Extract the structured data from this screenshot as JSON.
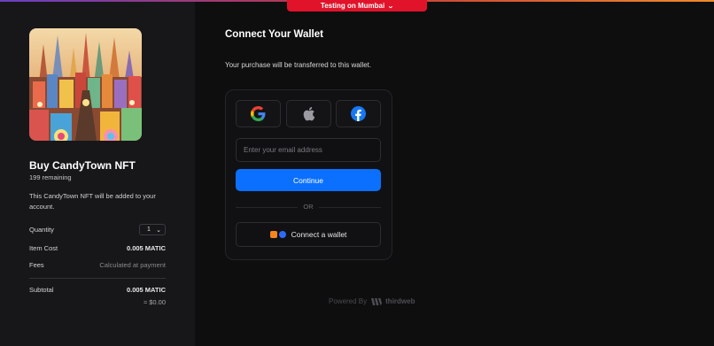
{
  "network": {
    "label": "Testing on Mumbai"
  },
  "product": {
    "title": "Buy CandyTown NFT",
    "remaining": "199 remaining",
    "description": "This CandyTown NFT will be added to your account."
  },
  "summary": {
    "quantity_label": "Quantity",
    "quantity_value": "1",
    "item_cost_label": "Item Cost",
    "item_cost_value": "0.005 MATIC",
    "fees_label": "Fees",
    "fees_value": "Calculated at payment",
    "subtotal_label": "Subtotal",
    "subtotal_value": "0.005 MATIC",
    "subtotal_usd": "≈ $0.00"
  },
  "wallet": {
    "title": "Connect Your Wallet",
    "subtitle": "Your purchase will be transferred to this wallet.",
    "social": [
      "google-icon",
      "apple-icon",
      "facebook-icon"
    ],
    "email_placeholder": "Enter your email address",
    "continue_label": "Continue",
    "or_label": "OR",
    "connect_wallet_label": "Connect a wallet"
  },
  "footer": {
    "powered_by": "Powered By",
    "brand": "thirdweb"
  },
  "colors": {
    "accent": "#0b70ff",
    "network_badge": "#e0132a",
    "panel": "#17171a",
    "background": "#0e0e0f"
  }
}
